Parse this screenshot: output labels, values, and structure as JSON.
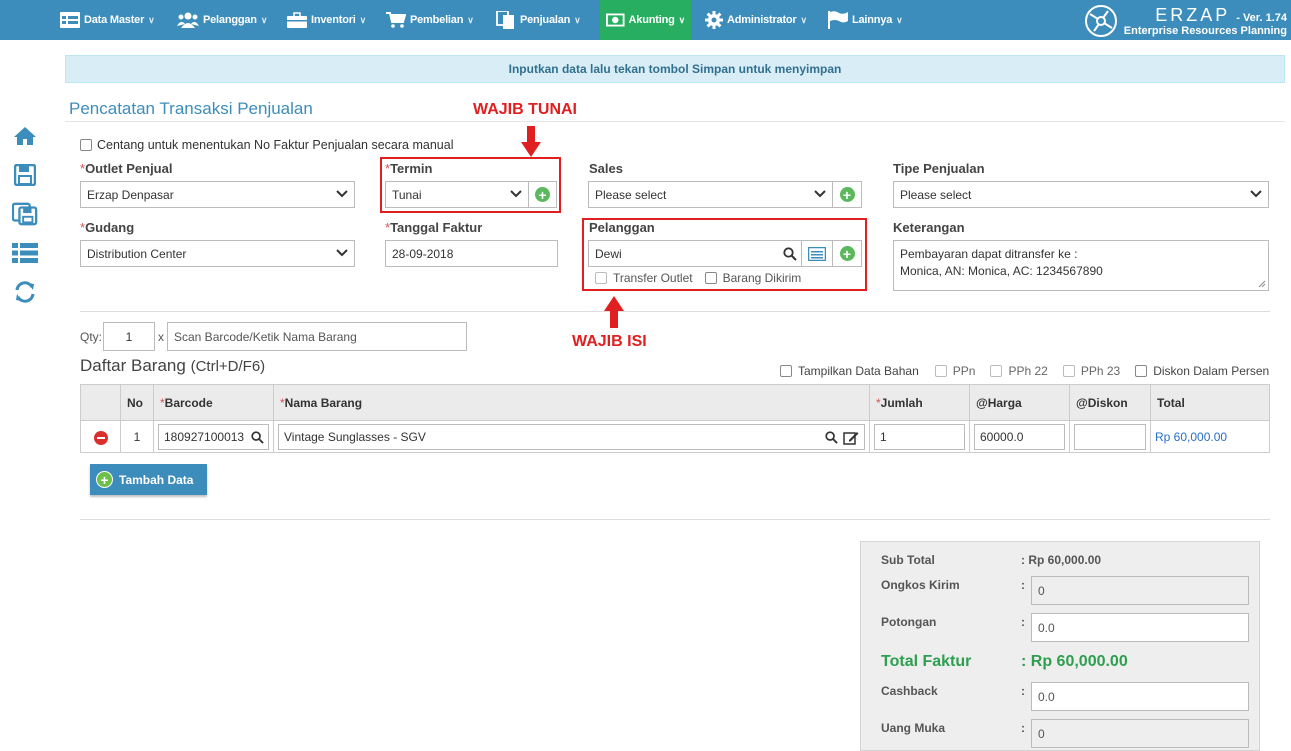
{
  "nav": {
    "items": [
      {
        "label": "Data Master",
        "icon": "table-icon"
      },
      {
        "label": "Pelanggan",
        "icon": "users-icon"
      },
      {
        "label": "Inventori",
        "icon": "briefcase-icon"
      },
      {
        "label": "Pembelian",
        "icon": "cart-icon"
      },
      {
        "label": "Penjualan",
        "icon": "document-icon"
      },
      {
        "label": "Akunting",
        "icon": "money-icon"
      },
      {
        "label": "Administrator",
        "icon": "gear-icon"
      },
      {
        "label": "Lainnya",
        "icon": "flag-icon"
      }
    ],
    "brand_name": "ERZAP",
    "version": "- Ver. 1.74",
    "brand_sub": "Enterprise Resources Planning",
    "active_color": "#27ae60",
    "bar_color": "#3c8dbc"
  },
  "sidebar": [
    "home-icon",
    "save-icon",
    "save-all-icon",
    "list-icon",
    "refresh-icon"
  ],
  "info_message": "Inputkan data lalu tekan tombol Simpan untuk menyimpan",
  "page_title": "Pencatatan Transaksi Penjualan",
  "annotations": {
    "tunai": "WAJIB TUNAI",
    "isi": "WAJIB ISI"
  },
  "form": {
    "manual_faktur_label": "Centang untuk menentukan No Faktur Penjualan secara manual",
    "outlet": {
      "label": "Outlet Penjual",
      "value": "Erzap Denpasar"
    },
    "termin": {
      "label": "Termin",
      "value": "Tunai"
    },
    "sales": {
      "label": "Sales",
      "placeholder": "Please select"
    },
    "tipe": {
      "label": "Tipe Penjualan",
      "placeholder": "Please select"
    },
    "gudang": {
      "label": "Gudang",
      "value": "Distribution Center"
    },
    "tanggal": {
      "label": "Tanggal Faktur",
      "value": "28-09-2018"
    },
    "pelanggan": {
      "label": "Pelanggan",
      "value": "Dewi"
    },
    "transfer_outlet": "Transfer Outlet",
    "barang_dikirim": "Barang Dikirim",
    "keterangan": {
      "label": "Keterangan",
      "line1": "Pembayaran dapat ditransfer ke :",
      "line2": "Monica, AN: Monica, AC: 1234567890"
    }
  },
  "scan": {
    "qty_label": "Qty:",
    "qty_value": "1",
    "x_label": "x",
    "placeholder": "Scan Barcode/Ketik Nama Barang"
  },
  "daftar": {
    "title": "Daftar Barang",
    "shortcut": "(Ctrl+D/F6)",
    "options": [
      "Tampilkan Data Bahan",
      "PPn",
      "PPh 22",
      "PPh 23",
      "Diskon Dalam Persen"
    ]
  },
  "table": {
    "headers": {
      "no": "No",
      "barcode": "Barcode",
      "nama": "Nama Barang",
      "jumlah": "Jumlah",
      "harga": "@Harga",
      "diskon": "@Diskon",
      "total": "Total"
    },
    "rows": [
      {
        "no": "1",
        "barcode": "180927100013",
        "nama": "Vintage Sunglasses - SGV",
        "jumlah": "1",
        "harga": "60000.0",
        "diskon": "",
        "total": "Rp 60,000.00"
      }
    ]
  },
  "tambah_label": "Tambah Data",
  "summary": {
    "subtotal_label": "Sub Total",
    "subtotal_value": ": Rp 60,000.00",
    "ongkos_label": "Ongkos Kirim",
    "ongkos_value": "0",
    "potongan_label": "Potongan",
    "potongan_value": "0.0",
    "total_label": "Total Faktur",
    "total_value": ": Rp 60,000.00",
    "cashback_label": "Cashback",
    "cashback_value": "0.0",
    "uangmuka_label": "Uang Muka",
    "uangmuka_value": "0",
    "colon": ":"
  }
}
